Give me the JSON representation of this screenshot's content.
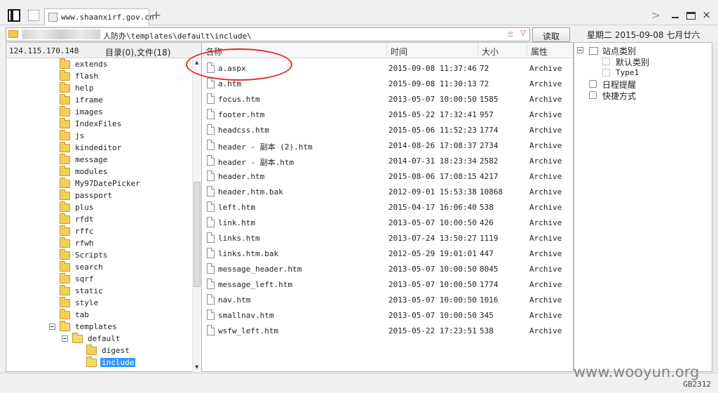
{
  "tab": {
    "title": "www.shaanxirf.gov.cn",
    "new_tab": "+"
  },
  "window": {
    "chevron": ">",
    "close": "×"
  },
  "address": {
    "path": "人防办\\templates\\default\\include\\",
    "plusminus": "±",
    "dropdown": "▽",
    "read_button": "读取"
  },
  "date_text": "星期二 2015-09-08 七月廿六",
  "left_panel": {
    "ip": "124.115.170.148",
    "dir_info": "目录(0),文件(18)",
    "tree": [
      {
        "label": "extends",
        "level": 1,
        "open": false
      },
      {
        "label": "flash",
        "level": 1,
        "open": false
      },
      {
        "label": "help",
        "level": 1,
        "open": false
      },
      {
        "label": "iframe",
        "level": 1,
        "open": false
      },
      {
        "label": "images",
        "level": 1,
        "open": false
      },
      {
        "label": "IndexFiles",
        "level": 1,
        "open": false
      },
      {
        "label": "js",
        "level": 1,
        "open": false
      },
      {
        "label": "kindeditor",
        "level": 1,
        "open": false
      },
      {
        "label": "message",
        "level": 1,
        "open": false
      },
      {
        "label": "modules",
        "level": 1,
        "open": false
      },
      {
        "label": "My97DatePicker",
        "level": 1,
        "open": false
      },
      {
        "label": "passport",
        "level": 1,
        "open": false
      },
      {
        "label": "plus",
        "level": 1,
        "open": false
      },
      {
        "label": "rfdt",
        "level": 1,
        "open": false
      },
      {
        "label": "rffc",
        "level": 1,
        "open": false
      },
      {
        "label": "rfwh",
        "level": 1,
        "open": false
      },
      {
        "label": "Scripts",
        "level": 1,
        "open": false
      },
      {
        "label": "search",
        "level": 1,
        "open": false
      },
      {
        "label": "sqrf",
        "level": 1,
        "open": false
      },
      {
        "label": "static",
        "level": 1,
        "open": false
      },
      {
        "label": "style",
        "level": 1,
        "open": false
      },
      {
        "label": "tab",
        "level": 1,
        "open": false
      },
      {
        "label": "templates",
        "level": 1,
        "open": true,
        "expander": true
      },
      {
        "label": "default",
        "level": 2,
        "open": true,
        "expander": true
      },
      {
        "label": "digest",
        "level": 3,
        "open": false
      },
      {
        "label": "include",
        "level": 3,
        "open": true,
        "selected": true
      }
    ]
  },
  "file_list": {
    "columns": {
      "name": "名称",
      "time": "时间",
      "size": "大小",
      "attr": "属性"
    },
    "rows": [
      {
        "name": "a.aspx",
        "time": "2015-09-08 11:37:46",
        "size": "72",
        "attr": "Archive"
      },
      {
        "name": "a.htm",
        "time": "2015-09-08 11:30:13",
        "size": "72",
        "attr": "Archive"
      },
      {
        "name": "focus.htm",
        "time": "2013-05-07 10:00:50",
        "size": "1585",
        "attr": "Archive"
      },
      {
        "name": "footer.htm",
        "time": "2015-05-22 17:32:41",
        "size": "957",
        "attr": "Archive"
      },
      {
        "name": "headcss.htm",
        "time": "2015-05-06 11:52:23",
        "size": "1774",
        "attr": "Archive"
      },
      {
        "name": "header - 副本 (2).htm",
        "time": "2014-08-26 17:08:37",
        "size": "2734",
        "attr": "Archive"
      },
      {
        "name": "header - 副本.htm",
        "time": "2014-07-31 18:23:34",
        "size": "2582",
        "attr": "Archive"
      },
      {
        "name": "header.htm",
        "time": "2015-08-06 17:08:15",
        "size": "4217",
        "attr": "Archive"
      },
      {
        "name": "header.htm.bak",
        "time": "2012-09-01 15:53:38",
        "size": "10868",
        "attr": "Archive"
      },
      {
        "name": "left.htm",
        "time": "2015-04-17 16:06:40",
        "size": "538",
        "attr": "Archive"
      },
      {
        "name": "link.htm",
        "time": "2013-05-07 10:00:50",
        "size": "426",
        "attr": "Archive"
      },
      {
        "name": "links.htm",
        "time": "2013-07-24 13:50:27",
        "size": "1119",
        "attr": "Archive"
      },
      {
        "name": "links.htm.bak",
        "time": "2012-05-29 19:01:01",
        "size": "447",
        "attr": "Archive"
      },
      {
        "name": "message_header.htm",
        "time": "2013-05-07 10:00:50",
        "size": "8045",
        "attr": "Archive"
      },
      {
        "name": "message_left.htm",
        "time": "2013-05-07 10:00:50",
        "size": "1774",
        "attr": "Archive"
      },
      {
        "name": "nav.htm",
        "time": "2013-05-07 10:00:50",
        "size": "1016",
        "attr": "Archive"
      },
      {
        "name": "smallnav.htm",
        "time": "2013-05-07 10:00:50",
        "size": "345",
        "attr": "Archive"
      },
      {
        "name": "wsfw_left.htm",
        "time": "2015-05-22 17:23:51",
        "size": "538",
        "attr": "Archive"
      }
    ]
  },
  "right_panel": {
    "site_category": "站点类别",
    "default_category": "默认类别",
    "type1": "Type1",
    "schedule": "日程提醒",
    "shortcuts": "快捷方式"
  },
  "status": {
    "encoding": "GB2312"
  },
  "watermark": "www.wooyun.org",
  "colors": {
    "selection": "#3399ff",
    "highlight_ring": "#e32b2b",
    "folder": "#f4ce58"
  }
}
